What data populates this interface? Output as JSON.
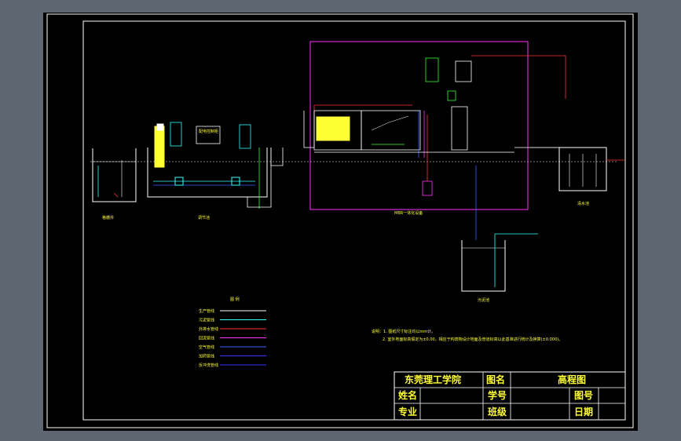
{
  "title_block": {
    "school": "东莞理工学院",
    "drawing_name_label": "图名",
    "drawing_name": "高程图",
    "name_label": "姓名",
    "student_id_label": "学号",
    "drawing_no_label": "图号",
    "major_label": "专业",
    "class_label": "班级",
    "date_label": "日期"
  },
  "legend": {
    "title": "图 例",
    "items": [
      {
        "label": "生产管线",
        "color": "#ffffff"
      },
      {
        "label": "污泥管线",
        "color": "#33ffff"
      },
      {
        "label": "外排水管线",
        "color": "#ff3333"
      },
      {
        "label": "回流管线",
        "color": "#ff33ff"
      },
      {
        "label": "空气管线",
        "color": "#3366ff"
      },
      {
        "label": "加药管线",
        "color": "#3333ff"
      },
      {
        "label": "反冲洗管线",
        "color": "#3333ff"
      }
    ]
  },
  "notes": {
    "line1": "说明：1. 图纸尺寸标注均以mm计。",
    "line2": "2. 室外地面标高假定为±0.00，相应于构筑物设计地面及管道标高以此基准进行统计及换算(±0.000)。"
  },
  "labels": {
    "grille_well": "格栅井",
    "adjust_tank": "调节池",
    "mbr_unit": "MBR一体化设备",
    "clear_tank": "清水池",
    "sludge_tank": "污泥池",
    "control_box": "配电控制柜"
  },
  "colors": {
    "frame": "#ffffff",
    "magenta": "#ff33ff",
    "yellow": "#ffff33",
    "cyan": "#33ffff",
    "green": "#33ff33",
    "red": "#ff3333",
    "blue": "#3366ff"
  }
}
